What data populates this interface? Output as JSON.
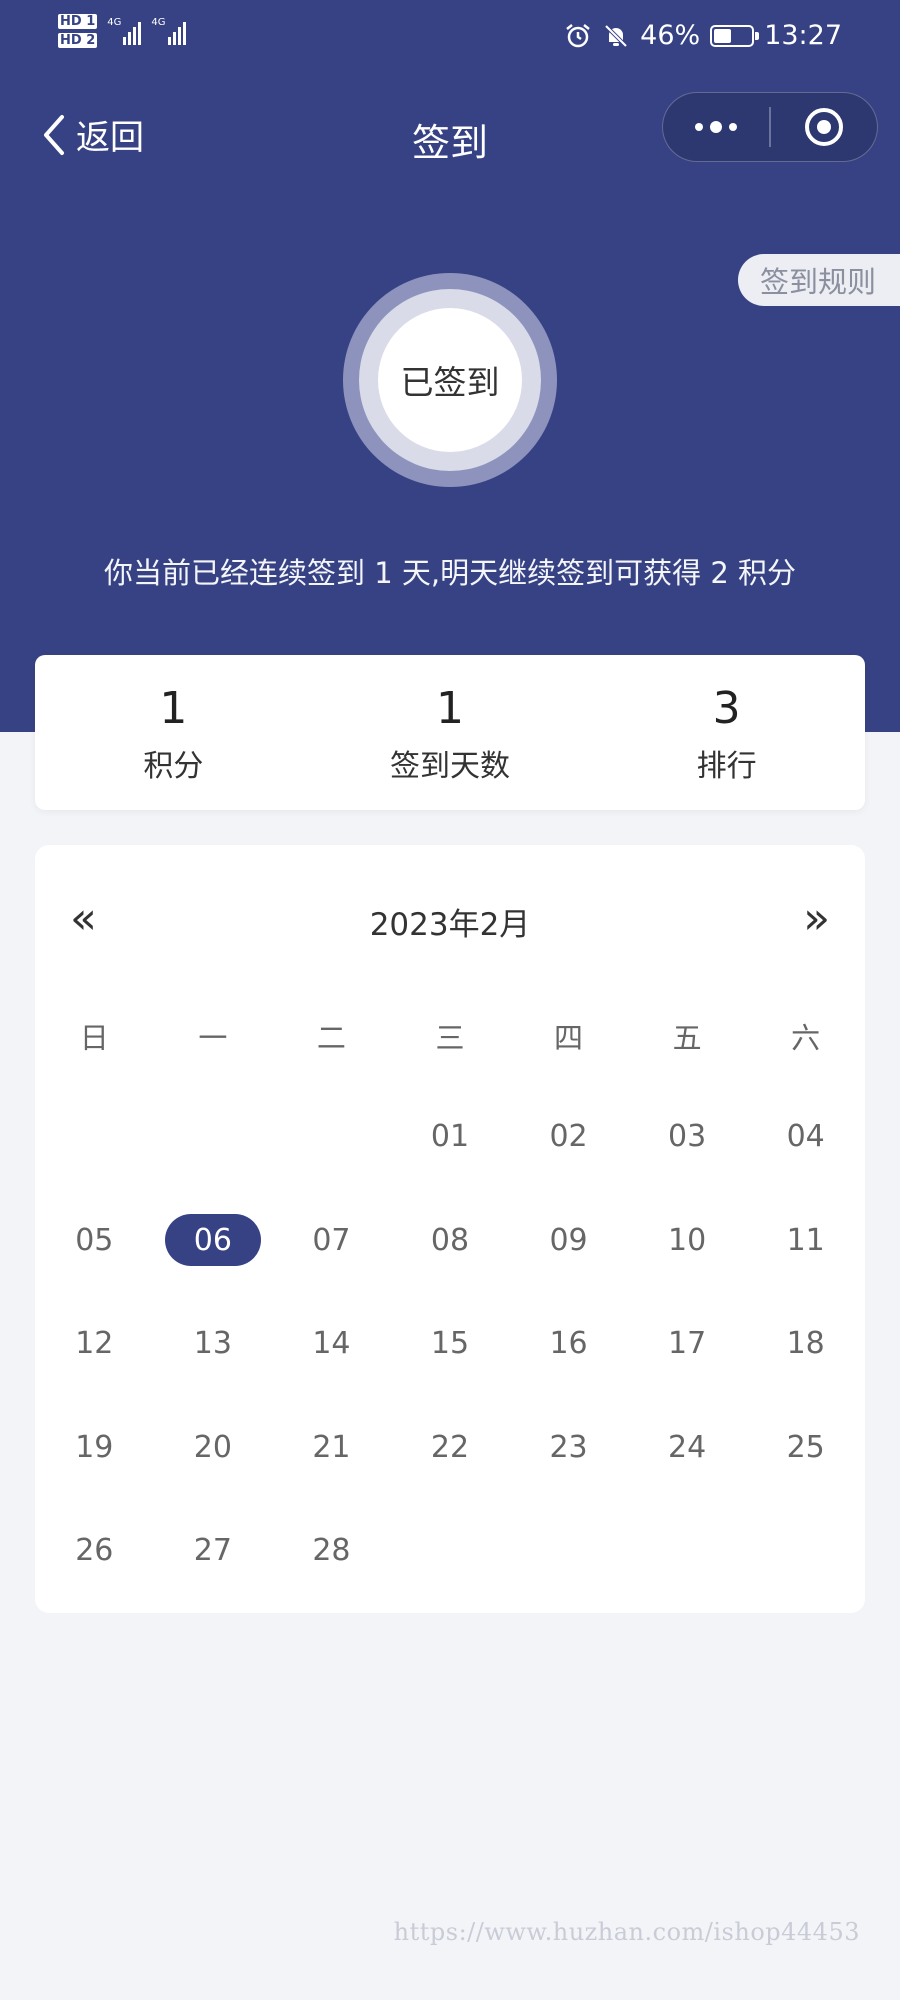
{
  "status_bar": {
    "sim1": "HD 1",
    "sim2": "HD 2",
    "net1": "4G",
    "net2": "4G",
    "battery_percent": "46%",
    "battery_level": 0.46,
    "time": "13:27"
  },
  "nav": {
    "back_label": "返回",
    "title": "签到"
  },
  "rules_label": "签到规则",
  "checkin_button": "已签到",
  "streak_message": "你当前已经连续签到 1 天,明天继续签到可获得 2 积分",
  "stats": [
    {
      "value": "1",
      "label": "积分"
    },
    {
      "value": "1",
      "label": "签到天数"
    },
    {
      "value": "3",
      "label": "排行"
    }
  ],
  "calendar": {
    "prev": "«",
    "next": "»",
    "title": "2023年2月",
    "weekdays": [
      "日",
      "一",
      "二",
      "三",
      "四",
      "五",
      "六"
    ],
    "leading_blanks": 3,
    "days": [
      "01",
      "02",
      "03",
      "04",
      "05",
      "06",
      "07",
      "08",
      "09",
      "10",
      "11",
      "12",
      "13",
      "14",
      "15",
      "16",
      "17",
      "18",
      "19",
      "20",
      "21",
      "22",
      "23",
      "24",
      "25",
      "26",
      "27",
      "28"
    ],
    "selected": "06"
  },
  "watermark": "https://www.huzhan.com/ishop44453",
  "colors": {
    "primary": "#374284",
    "background": "#f3f4f8"
  }
}
